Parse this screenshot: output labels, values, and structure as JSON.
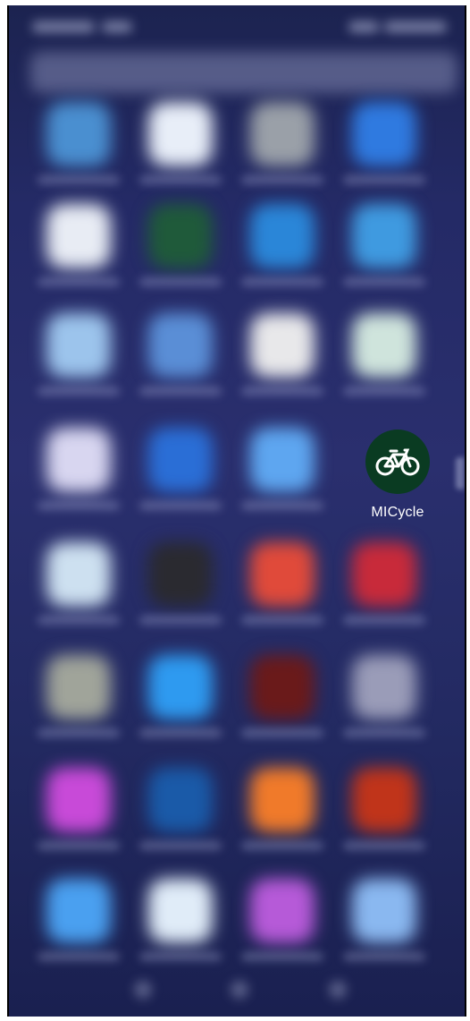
{
  "screen": {
    "background_color": "#242a66"
  },
  "status_bar": {
    "blurred": true
  },
  "search_bar": {
    "blurred": true
  },
  "apps": [
    {
      "color": "#4a8fd0"
    },
    {
      "color": "#e8eef8"
    },
    {
      "color": "#9aa0a8"
    },
    {
      "color": "#2f7ae0"
    },
    {
      "color": "#e8ecf4"
    },
    {
      "color": "#1f5a3a"
    },
    {
      "color": "#2a86d8"
    },
    {
      "color": "#3f9ae0"
    },
    {
      "color": "#9cc4ec"
    },
    {
      "color": "#5a8ed6"
    },
    {
      "color": "#e8e8ea"
    },
    {
      "color": "#cfe4dc"
    },
    {
      "color": "#d8d6f0"
    },
    {
      "color": "#2a6ed6"
    },
    {
      "color": "#5ea6f0"
    },
    {
      "color": "#0a3b22"
    },
    {
      "color": "#cde0f0"
    },
    {
      "color": "#2a2a30"
    },
    {
      "color": "#e04a3a"
    },
    {
      "color": "#c82a3a"
    },
    {
      "color": "#a0a49a"
    },
    {
      "color": "#2e9af0"
    },
    {
      "color": "#6a1a1a"
    },
    {
      "color": "#9a9cb8"
    },
    {
      "color": "#c84ad8"
    },
    {
      "color": "#1a5aa8"
    },
    {
      "color": "#f07a2a"
    },
    {
      "color": "#c0341a"
    },
    {
      "color": "#4aa0f0"
    },
    {
      "color": "#e0ecf8"
    },
    {
      "color": "#b65ad8"
    },
    {
      "color": "#8ab8f0"
    }
  ],
  "highlighted_app": {
    "label": "MICycle",
    "icon": "bicycle-icon",
    "icon_bg_color": "#0a3b22",
    "icon_fg_color": "#ffffff"
  },
  "nav_bar": {
    "buttons": [
      "back",
      "home",
      "recents"
    ]
  }
}
